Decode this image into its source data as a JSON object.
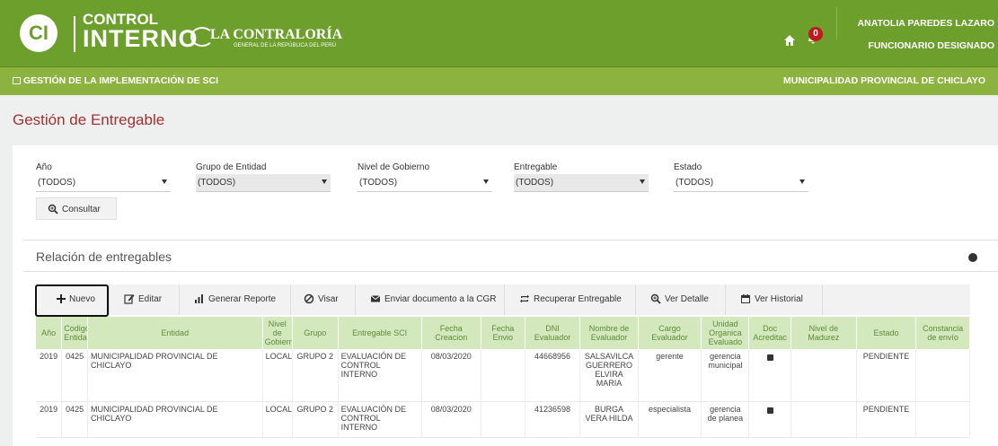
{
  "header": {
    "logo_line1": "CONTROL",
    "logo_line2": "INTERNO",
    "logo_mark": "CI",
    "cgr_name": "LA CONTRALORÍA",
    "cgr_sub": "GENERAL DE LA REPÚBLICA DEL PERÚ",
    "notifications_count": "0",
    "user_name": "ANATOLIA PAREDES LAZARO",
    "user_role": "FUNCIONARIO DESIGNADO",
    "accent": "#6d9f2c"
  },
  "subheader": {
    "section": "GESTIÓN DE LA IMPLEMENTACIÓN DE SCI",
    "entity": "MUNICIPALIDAD PROVINCIAL DE CHICLAYO"
  },
  "page": {
    "title": "Gestión de Entregable"
  },
  "filters": {
    "anio": {
      "label": "Año",
      "value": "(TODOS)"
    },
    "grupo": {
      "label": "Grupo de Entidad",
      "value": "(TODOS)"
    },
    "nivel": {
      "label": "Nivel de Gobierno",
      "value": "(TODOS)"
    },
    "entregable": {
      "label": "Entregable",
      "value": "(TODOS)"
    },
    "estado": {
      "label": "Estado",
      "value": "(TODOS)"
    },
    "consultar_label": "Consultar"
  },
  "panel": {
    "title": "Relación de entregables"
  },
  "toolbar": {
    "nuevo": "Nuevo",
    "editar": "Editar",
    "generar": "Generar Reporte",
    "visar": "Visar",
    "enviar": "Enviar documento a la CGR",
    "recuperar": "Recuperar Entregable",
    "detalle": "Ver Detalle",
    "historial": "Ver Historial"
  },
  "table": {
    "headers": [
      "Año",
      "Codigo Entidad",
      "Entidad",
      "Nivel de Gobierno",
      "Grupo",
      "Entregable SCI",
      "Fecha Creacion",
      "Fecha Envio",
      "DNI Evaluador",
      "Nombre de Evaluador",
      "Cargo Evaluador",
      "Unidad Organica Evaluado",
      "Doc Acreditac",
      "Nivel de Madurez",
      "Estado",
      "Constancia de envío"
    ],
    "rows": [
      {
        "anio": "2019",
        "codigo": "0425",
        "entidad": "MUNICIPALIDAD PROVINCIAL DE CHICLAYO",
        "nivel": "LOCAL",
        "grupo": "GRUPO 2",
        "entregable": "EVALUACIÓN DE CONTROL INTERNO",
        "fecha_creacion": "08/03/2020",
        "fecha_envio": "",
        "dni": "44668956",
        "nombre": "SALSAVILCA GUERRERO ELVIRA MARIA",
        "cargo": "gerente",
        "unidad": "gerencia municipal",
        "madurez": "",
        "estado": "PENDIENTE",
        "constancia": ""
      },
      {
        "anio": "2019",
        "codigo": "0425",
        "entidad": "MUNICIPALIDAD PROVINCIAL DE CHICLAYO",
        "nivel": "LOCAL",
        "grupo": "GRUPO 2",
        "entregable": "EVALUACIÓN DE CONTROL INTERNO",
        "fecha_creacion": "08/03/2020",
        "fecha_envio": "",
        "dni": "41236598",
        "nombre": "BURGA VERA HILDA",
        "cargo": "especialista",
        "unidad": "gerencia de planea",
        "madurez": "",
        "estado": "PENDIENTE",
        "constancia": ""
      }
    ]
  }
}
